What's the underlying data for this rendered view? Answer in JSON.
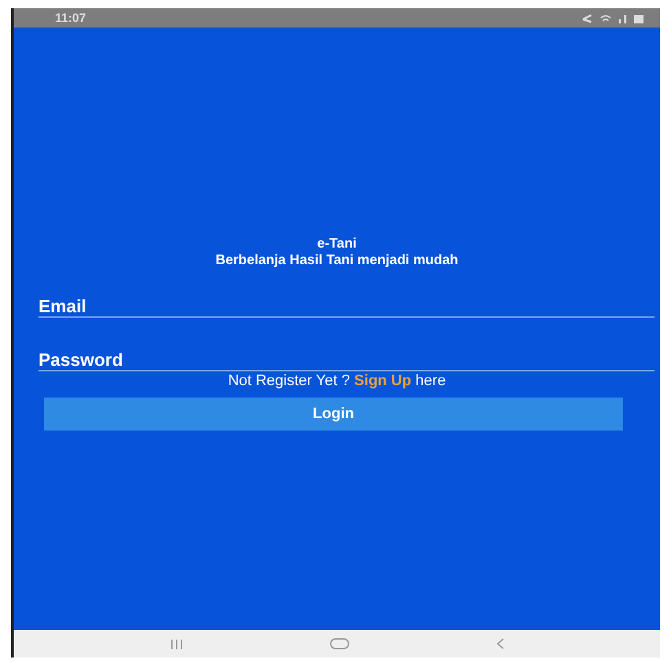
{
  "status_bar": {
    "time": "11:07"
  },
  "header": {
    "app_name": "e-Tani",
    "tagline": "Berbelanja Hasil Tani menjadi mudah"
  },
  "fields": [
    {
      "label": "Email"
    },
    {
      "label": "Password"
    }
  ],
  "signup_prompt": {
    "before": "Not Register Yet ?",
    "link": "Sign Up",
    "after": "here"
  },
  "login_button": {
    "label": "Login"
  }
}
